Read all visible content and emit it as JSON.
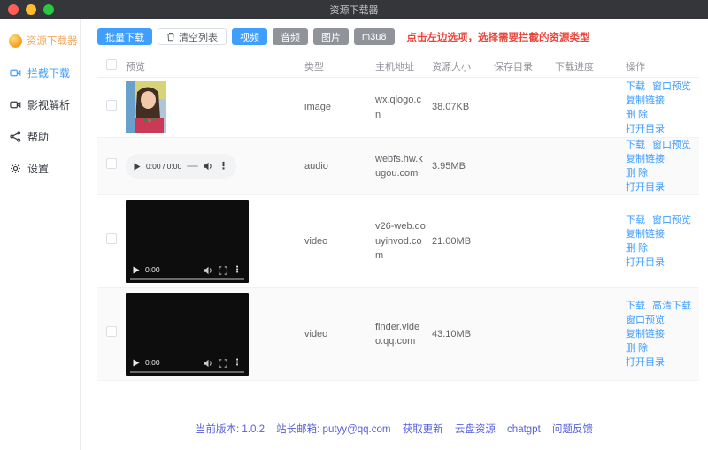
{
  "window": {
    "title": "资源下载器"
  },
  "colors": {
    "accent_blue": "#409eff",
    "gray_button": "#909399",
    "danger_red": "#e8453c",
    "link_blue": "#409eff",
    "footer_indigo": "#5560d8",
    "logo_orange": "#f3a75c",
    "titlebar_bg": "#35363a"
  },
  "sidebar": {
    "logo_text": "资源下载器",
    "items": [
      {
        "label": "拦截下载",
        "icon": "intercept-download-icon",
        "active": true
      },
      {
        "label": "影视解析",
        "icon": "video-parse-icon",
        "active": false
      },
      {
        "label": "帮助",
        "icon": "share-icon",
        "active": false
      },
      {
        "label": "设置",
        "icon": "gear-icon",
        "active": false
      }
    ]
  },
  "toolbar": {
    "buttons": [
      {
        "label": "批量下载",
        "style": "primary"
      },
      {
        "label": "清空列表",
        "style": "plain",
        "icon": "trash-icon"
      },
      {
        "label": "视频",
        "style": "primary"
      },
      {
        "label": "音频",
        "style": "gray"
      },
      {
        "label": "图片",
        "style": "gray"
      },
      {
        "label": "m3u8",
        "style": "gray"
      }
    ],
    "tip": "点击左边选项，选择需要拦截的资源类型"
  },
  "table": {
    "columns": [
      "预览",
      "类型",
      "主机地址",
      "资源大小",
      "保存目录",
      "下载进度",
      "操作"
    ],
    "rows": [
      {
        "preview": "image",
        "type": "image",
        "host": "wx.qlogo.cn",
        "size": "38.07KB",
        "save_dir": "",
        "progress": "",
        "media_time": "",
        "action_lines": [
          [
            "下载",
            "窗口预览"
          ],
          [
            "复制链接"
          ],
          [
            "删 除"
          ],
          [
            "打开目录"
          ]
        ]
      },
      {
        "preview": "audio",
        "type": "audio",
        "host": "webfs.hw.kugou.com",
        "size": "3.95MB",
        "save_dir": "",
        "progress": "",
        "media_time": "0:00 / 0:00",
        "action_lines": [
          [
            "下载",
            "窗口预览"
          ],
          [
            "复制链接"
          ],
          [
            "删 除"
          ],
          [
            "打开目录"
          ]
        ]
      },
      {
        "preview": "video",
        "type": "video",
        "host": "v26-web.douyinvod.com",
        "size": "21.00MB",
        "save_dir": "",
        "progress": "",
        "media_time": "0:00",
        "action_lines": [
          [
            "下载",
            "窗口预览"
          ],
          [
            "复制链接"
          ],
          [
            "删 除"
          ],
          [
            "打开目录"
          ]
        ]
      },
      {
        "preview": "video",
        "type": "video",
        "host": "finder.video.qq.com",
        "size": "43.10MB",
        "save_dir": "",
        "progress": "",
        "media_time": "0:00",
        "action_lines": [
          [
            "下载",
            "高清下载"
          ],
          [
            "窗口预览"
          ],
          [
            "复制链接"
          ],
          [
            "删 除"
          ],
          [
            "打开目录"
          ]
        ]
      }
    ]
  },
  "footer": {
    "version_label": "当前版本: 1.0.2",
    "email_label": "站长邮箱: putyy@qq.com",
    "links": [
      "获取更新",
      "云盘资源",
      "chatgpt",
      "问题反馈"
    ]
  }
}
